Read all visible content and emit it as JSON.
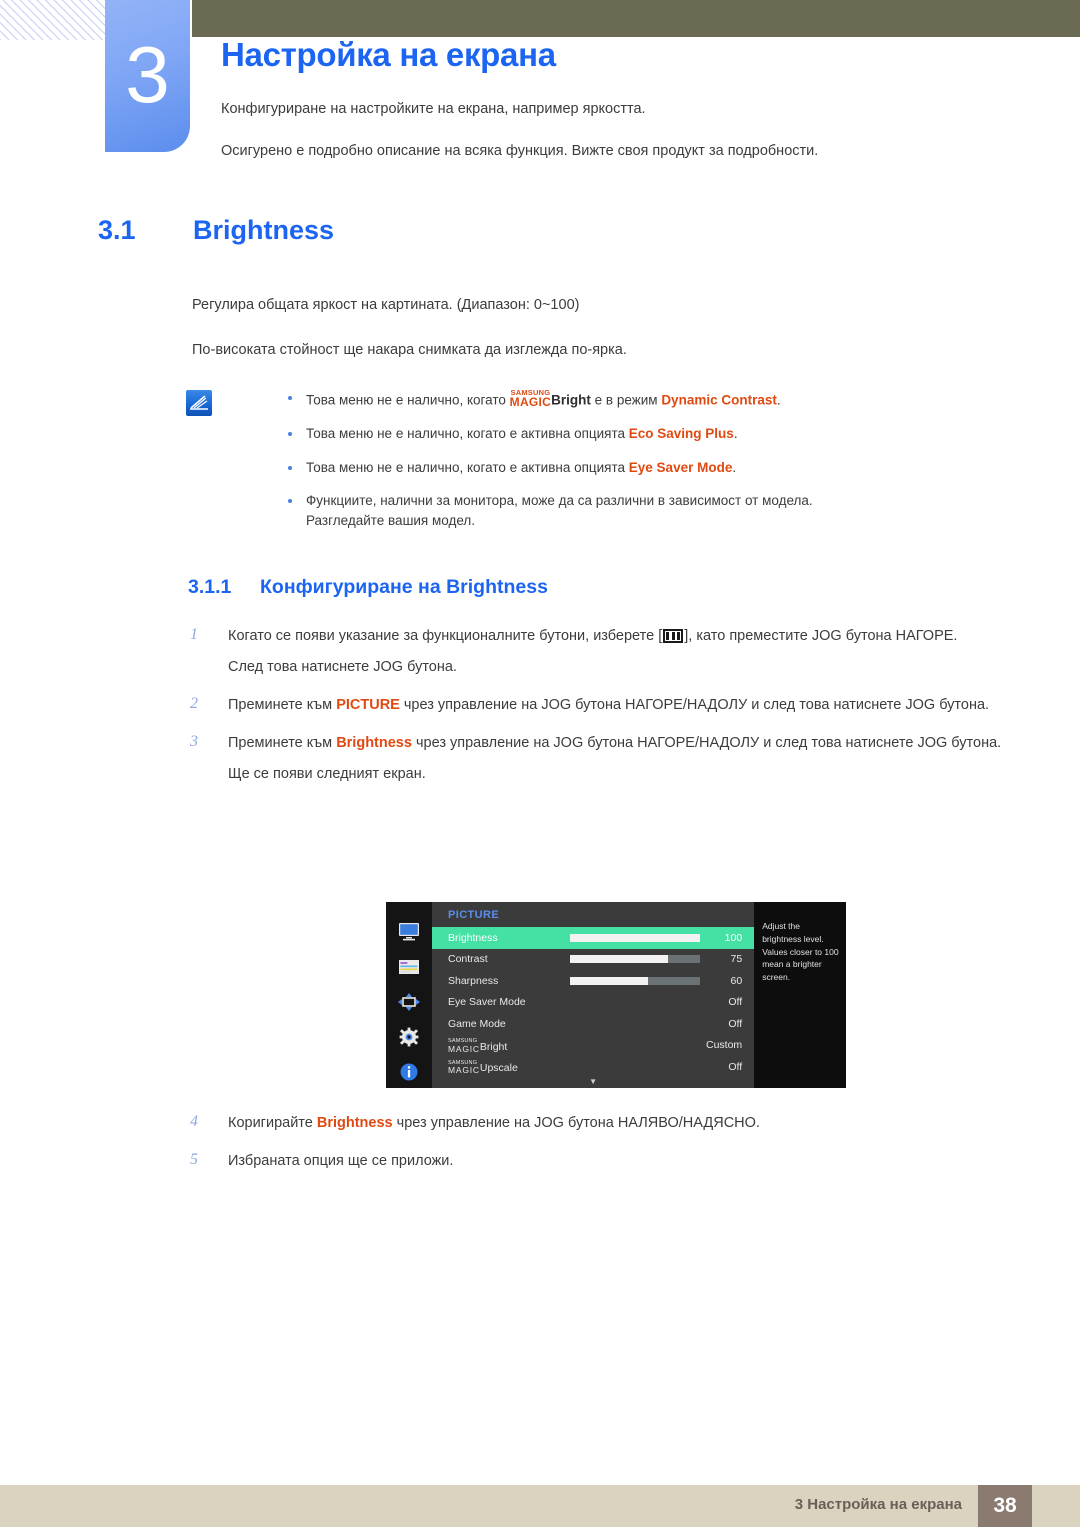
{
  "header": {
    "chapter_number": "3",
    "chapter_title": "Настройка на екрана",
    "sub_line_1": "Конфигуриране на настройките на екрана, например яркостта.",
    "sub_line_2": "Осигурено е подробно описание на всяка функция. Вижте своя продукт за подробности."
  },
  "section": {
    "number": "3.1",
    "title": "Brightness",
    "para_1": "Регулира общата яркост на картината. (Диапазон: 0~100)",
    "para_2": "По-високата стойност ще накара снимката да изглежда по-ярка."
  },
  "note": {
    "icon_name": "note-pen-icon",
    "items": [
      {
        "prefix": "Това меню не е налично, когато ",
        "magic_top": "SAMSUNG",
        "magic_bottom": "MAGIC",
        "magic_word": "Bright",
        "middle": " е в режим ",
        "highlight": "Dynamic Contrast",
        "suffix": "."
      },
      {
        "prefix": "Това меню не е налично, когато е активна опцията ",
        "highlight": "Eco Saving Plus",
        "suffix": "."
      },
      {
        "prefix": "Това меню не е налично, когато е активна опцията ",
        "highlight": "Eye Saver Mode",
        "suffix": "."
      },
      {
        "prefix": "Функциите, налични за монитора, може да са различни в зависимост от модела.",
        "second_line": "Разгледайте вашия модел."
      }
    ]
  },
  "subsection": {
    "number": "3.1.1",
    "title": "Конфигуриране на Brightness"
  },
  "steps": [
    {
      "num": "1",
      "text_before": "Когато се появи указание за функционалните бутони, изберете [",
      "icon_name": "menu-bars-icon",
      "text_after": "], като преместите JOG бутона НАГОРЕ.",
      "extra": "След това натиснете JOG бутона."
    },
    {
      "num": "2",
      "text_before": "Преминете към ",
      "highlight": "PICTURE",
      "text_after": " чрез управление на JOG бутона НАГОРЕ/НАДОЛУ и след това натиснете JOG бутона."
    },
    {
      "num": "3",
      "text_before": "Преминете към ",
      "highlight": "Brightness",
      "text_after": " чрез управление на JOG бутона НАГОРЕ/НАДОЛУ и след това натиснете JOG бутона.",
      "extra": "Ще се появи следният екран."
    },
    {
      "num": "4",
      "text_before": "Коригирайте ",
      "highlight": "Brightness",
      "text_after": " чрез управление на JOG бутона НАЛЯВО/НАДЯСНО."
    },
    {
      "num": "5",
      "text_before": "Избраната опция ще се приложи."
    }
  ],
  "osd": {
    "title": "PICTURE",
    "sidebar_icons": [
      "monitor-icon",
      "osd-menu-icon",
      "four-arrows-icon",
      "gear-icon",
      "info-icon"
    ],
    "rows": [
      {
        "label": "Brightness",
        "value": "100",
        "slider": 100,
        "active": true,
        "magic": false
      },
      {
        "label": "Contrast",
        "value": "75",
        "slider": 75,
        "active": false,
        "magic": false
      },
      {
        "label": "Sharpness",
        "value": "60",
        "slider": 60,
        "active": false,
        "magic": false
      },
      {
        "label": "Eye Saver Mode",
        "value": "Off",
        "slider": null,
        "active": false,
        "magic": false
      },
      {
        "label": "Game Mode",
        "value": "Off",
        "slider": null,
        "active": false,
        "magic": false
      },
      {
        "label": "Bright",
        "value": "Custom",
        "slider": null,
        "active": false,
        "magic": true,
        "magic_top": "SAMSUNG",
        "magic_bottom": "MAGIC"
      },
      {
        "label": "Upscale",
        "value": "Off",
        "slider": null,
        "active": false,
        "magic": true,
        "magic_top": "SAMSUNG",
        "magic_bottom": "MAGIC"
      }
    ],
    "scroll_arrow": "▼",
    "description": "Adjust the brightness level. Values closer to 100 mean a brighter screen."
  },
  "footer": {
    "text": "3 Настройка на екрана",
    "page": "38"
  },
  "colors": {
    "accent_blue": "#1c64f2",
    "highlight_orange": "#e04a12",
    "olive_bar": "#6b6a53",
    "footer_bg": "#d9d3c0",
    "footer_page_bg": "#8a7a70",
    "osd_active_green": "#45e0a4"
  }
}
